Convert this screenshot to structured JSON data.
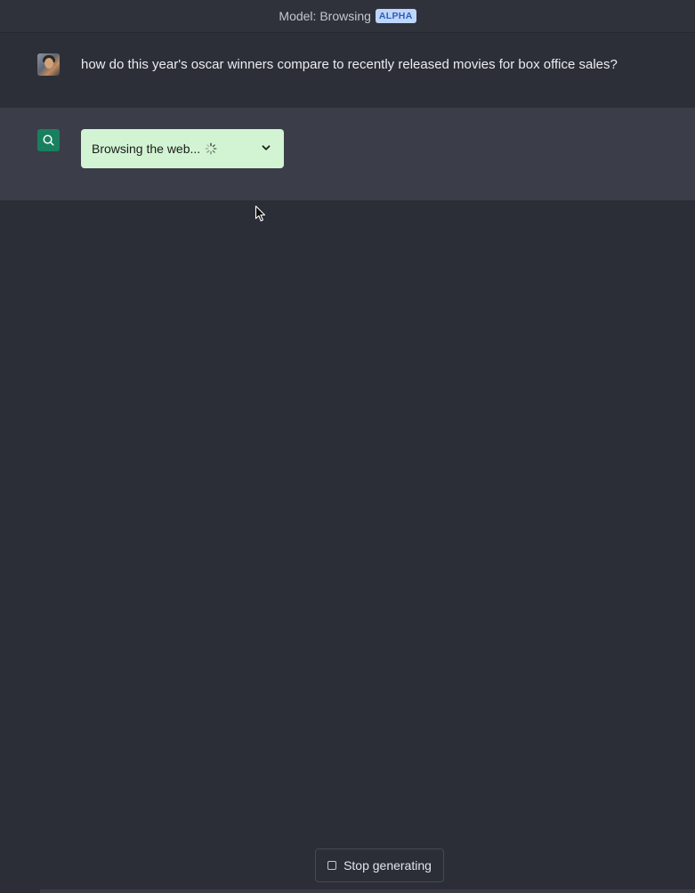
{
  "header": {
    "model_label": "Model: Browsing",
    "badge": "ALPHA"
  },
  "conversation": {
    "user_message": "how do this year's oscar winners compare to recently released movies for box office sales?",
    "assistant": {
      "status_text": "Browsing the web...",
      "status_icon": "spinner-icon",
      "expand_icon": "chevron-down-icon"
    }
  },
  "controls": {
    "stop_label": "Stop generating",
    "stop_icon": "stop-square-icon"
  },
  "colors": {
    "background": "#2b2e37",
    "assistant_row": "#3b3d49",
    "browse_box": "#d2f4d3",
    "assistant_avatar": "#19805f",
    "badge_bg": "#bfd6fb",
    "badge_text": "#2e5fb8"
  }
}
